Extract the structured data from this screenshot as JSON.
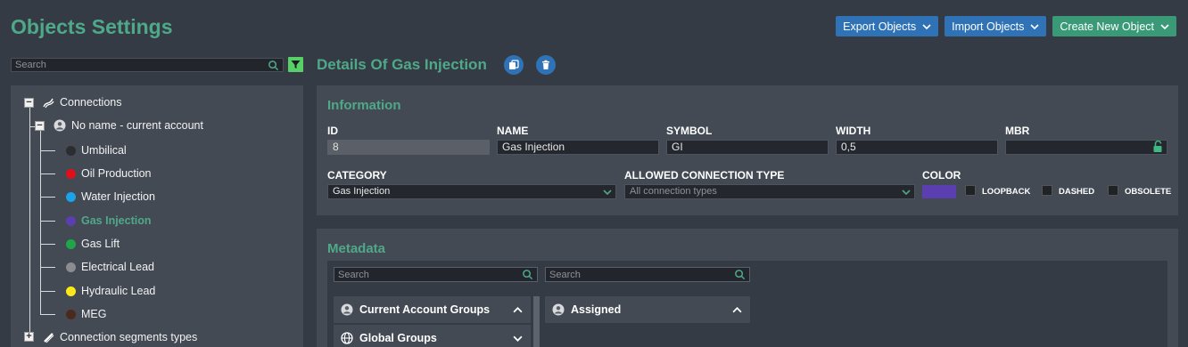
{
  "header": {
    "title": "Objects Settings",
    "actions": [
      {
        "label": "Export Objects"
      },
      {
        "label": "Import Objects"
      },
      {
        "label": "Create New Object"
      }
    ]
  },
  "left_search": {
    "placeholder": "Search"
  },
  "tree": {
    "root": "Connections",
    "account": "No name - current account",
    "items": [
      {
        "label": "Umbilical",
        "color": "#2b2d31"
      },
      {
        "label": "Oil Production",
        "color": "#e0101a"
      },
      {
        "label": "Water Injection",
        "color": "#1aa3e8"
      },
      {
        "label": "Gas Injection",
        "color": "#5b3fb0",
        "active": true
      },
      {
        "label": "Gas Lift",
        "color": "#1fa64a"
      },
      {
        "label": "Electrical Lead",
        "color": "#8a8c8f"
      },
      {
        "label": "Hydraulic Lead",
        "color": "#ffe81a"
      },
      {
        "label": "MEG",
        "color": "#4a2a1c"
      }
    ],
    "next_root": "Connection segments types"
  },
  "details": {
    "title": "Details Of Gas Injection",
    "copy_icon": "copy-icon",
    "delete_icon": "trash-icon"
  },
  "information": {
    "heading": "Information",
    "id_label": "ID",
    "id_value": "8",
    "name_label": "NAME",
    "name_value": "Gas Injection",
    "symbol_label": "SYMBOL",
    "symbol_value": "GI",
    "width_label": "WIDTH",
    "width_value": "0,5",
    "mbr_label": "MBR",
    "mbr_value": "",
    "category_label": "CATEGORY",
    "category_value": "Gas Injection",
    "allowed_label": "ALLOWED CONNECTION TYPE",
    "allowed_placeholder": "All connection types",
    "color_label": "COLOR",
    "color_value": "#5b3fb0",
    "loopback_label": "LOOPBACK",
    "dashed_label": "DASHED",
    "obsolete_label": "OBSOLETE"
  },
  "metadata": {
    "heading": "Metadata",
    "left_search_placeholder": "Search",
    "right_search_placeholder": "Search",
    "current_account_groups": "Current Account Groups",
    "global_groups": "Global Groups",
    "assigned": "Assigned"
  },
  "colors": {
    "accent_green": "#4fa989",
    "button_blue": "#2f73b6",
    "button_green": "#3a9a78",
    "background": "#353b45",
    "panel": "#434a54"
  }
}
